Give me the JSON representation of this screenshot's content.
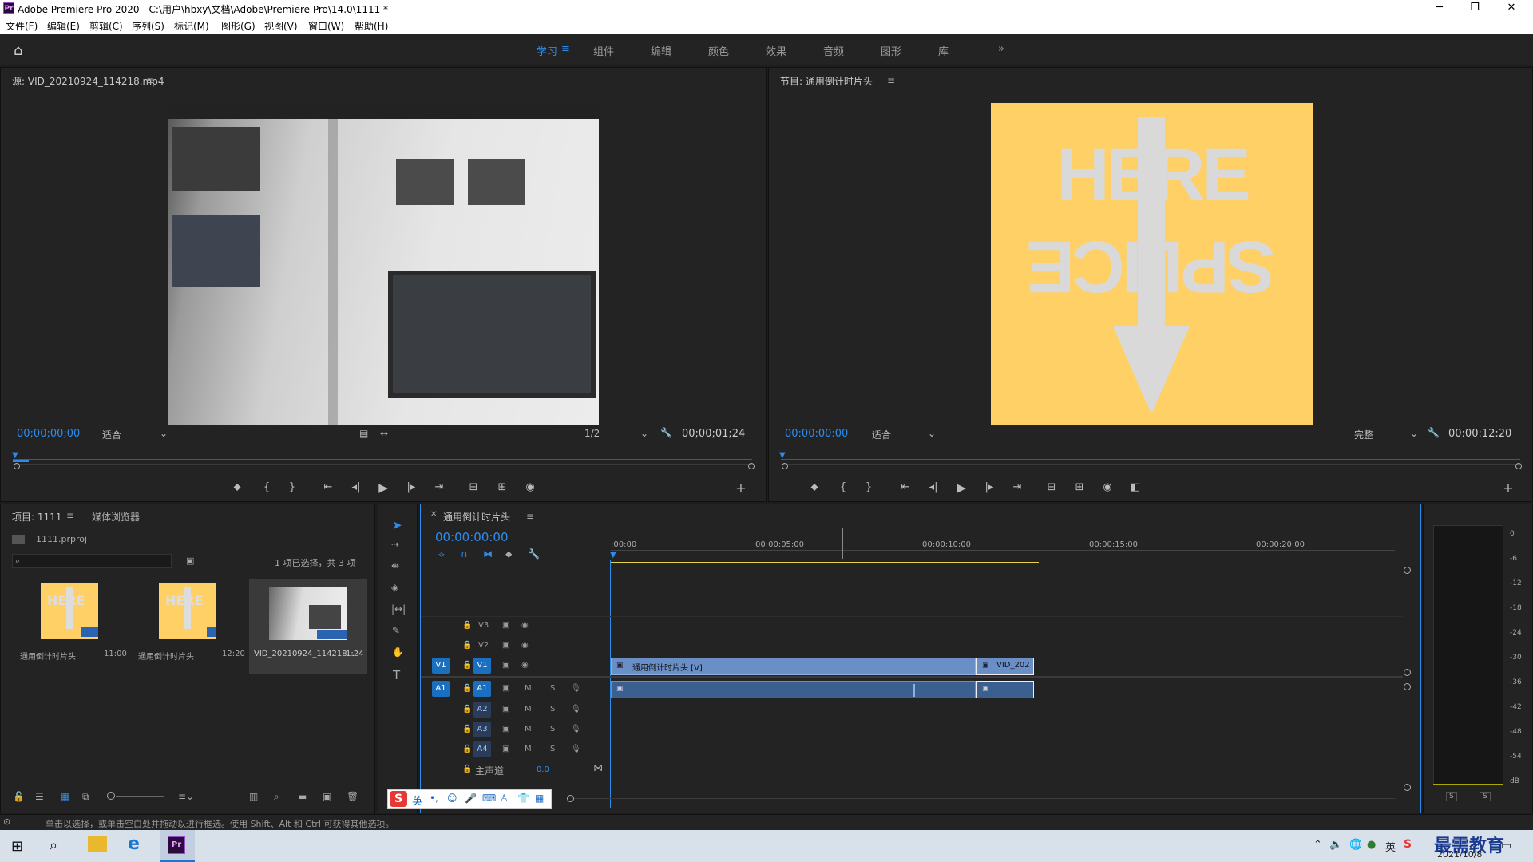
{
  "app": {
    "title": "Adobe Premiere Pro 2020 - C:\\用户\\hbxy\\文档\\Adobe\\Premiere Pro\\14.0\\1111 *",
    "logo": "Pr"
  },
  "menu": [
    "文件(F)",
    "编辑(E)",
    "剪辑(C)",
    "序列(S)",
    "标记(M)",
    "图形(G)",
    "视图(V)",
    "窗口(W)",
    "帮助(H)"
  ],
  "workspaces": [
    {
      "label": "学习",
      "active": true
    },
    {
      "label": "组件"
    },
    {
      "label": "编辑"
    },
    {
      "label": "颜色"
    },
    {
      "label": "效果"
    },
    {
      "label": "音频"
    },
    {
      "label": "图形"
    },
    {
      "label": "库"
    }
  ],
  "source": {
    "title": "源: VID_20210924_114218.mp4",
    "timecode": "00;00;00;00",
    "fit": "适合",
    "resolution": "1/2",
    "duration": "00;00;01;24"
  },
  "program": {
    "title": "节目: 通用倒计时片头",
    "timecode": "00:00:00:00",
    "fit": "适合",
    "quality": "完整",
    "duration": "00:00:12:20",
    "splice_top": "HERE",
    "splice_bottom": "SPLICE"
  },
  "project": {
    "tab1": "项目: 1111",
    "tab2": "媒体浏览器",
    "file": "1111.prproj",
    "selection": "1 项已选择，共 3 项",
    "items": [
      {
        "name": "通用倒计时片头",
        "duration": "11:00"
      },
      {
        "name": "通用倒计时片头",
        "duration": "12:20"
      },
      {
        "name": "VID_20210924_114218...",
        "duration": "1:24"
      }
    ]
  },
  "timeline": {
    "tab": "通用倒计时片头",
    "timecode": "00:00:00:00",
    "ruler": [
      ":00:00",
      "00:00:05:00",
      "00:00:10:00",
      "00:00:15:00",
      "00:00:20:00"
    ],
    "video_tracks": [
      "V3",
      "V2",
      "V1"
    ],
    "audio_tracks": [
      "A1",
      "A2",
      "A3",
      "A4"
    ],
    "master": "主声道",
    "master_value": "0.0",
    "clip_v1": "通用倒计时片头 [V]",
    "clip_v1b": "VID_202",
    "src_v": "V1",
    "src_a": "A1"
  },
  "meter": {
    "labels": [
      "0",
      "-6",
      "-12",
      "-18",
      "-24",
      "-30",
      "-36",
      "-42",
      "-48",
      "-54",
      "dB"
    ],
    "solo": [
      "S",
      "S"
    ]
  },
  "status": {
    "text": "单击以选择，或单击空白处并拖动以进行框选。使用 Shift、Alt 和 Ctrl 可获得其他选项。"
  },
  "ime": {
    "lang": "英"
  },
  "taskbar": {
    "date": "2021/10/8",
    "watermark": "最需教育"
  },
  "colors": {
    "accent": "#2d8ceb",
    "clip": "#6a8fc7",
    "yellow": "#ffd065"
  }
}
